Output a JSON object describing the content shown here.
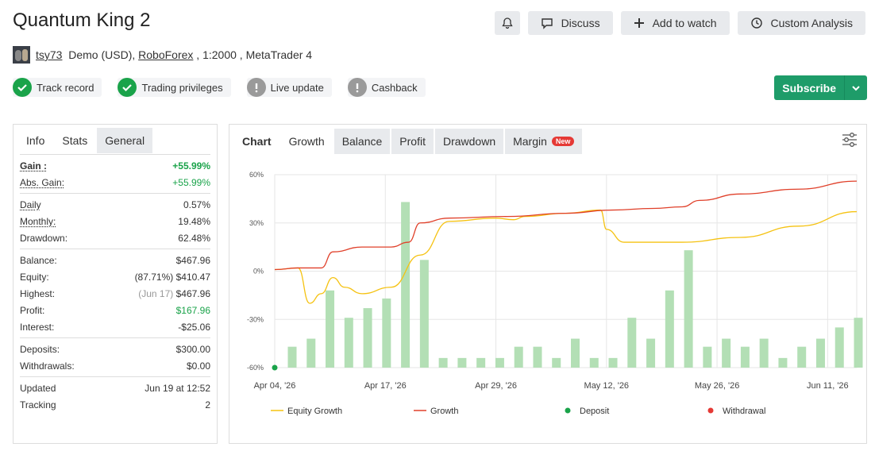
{
  "header": {
    "title": "Quantum King 2",
    "user": "tsy73",
    "account_type": "Demo (USD),",
    "broker": "RoboForex",
    "leverage_platform": " , 1:2000 , MetaTrader 4"
  },
  "actions": {
    "discuss": "Discuss",
    "add_to_watch": "Add to watch",
    "custom_analysis": "Custom Analysis",
    "subscribe": "Subscribe"
  },
  "badges": [
    {
      "label": "Track record",
      "status": "ok"
    },
    {
      "label": "Trading privileges",
      "status": "ok"
    },
    {
      "label": "Live update",
      "status": "warn"
    },
    {
      "label": "Cashback",
      "status": "warn"
    }
  ],
  "left_tabs": [
    "Info",
    "Stats",
    "General"
  ],
  "stats": {
    "gain_label": "Gain :",
    "gain": "+55.99%",
    "abs_gain_label": "Abs. Gain:",
    "abs_gain": "+55.99%",
    "daily_label": "Daily",
    "daily": "0.57%",
    "monthly_label": "Monthly:",
    "monthly": "19.48%",
    "drawdown_label": "Drawdown:",
    "drawdown": "62.48%",
    "balance_label": "Balance:",
    "balance": "$467.96",
    "equity_label": "Equity:",
    "equity_pct": "(87.71%)",
    "equity": "$410.47",
    "highest_label": "Highest:",
    "highest_date": "(Jun 17)",
    "highest": "$467.96",
    "profit_label": "Profit:",
    "profit": "$167.96",
    "interest_label": "Interest:",
    "interest": "-$25.06",
    "deposits_label": "Deposits:",
    "deposits": "$300.00",
    "withdrawals_label": "Withdrawals:",
    "withdrawals": "$0.00",
    "updated_label": "Updated",
    "updated": "Jun 19 at 12:52",
    "tracking_label": "Tracking",
    "tracking": "2"
  },
  "chart_tabs": {
    "chart": "Chart",
    "growth": "Growth",
    "balance": "Balance",
    "profit": "Profit",
    "drawdown": "Drawdown",
    "margin": "Margin",
    "new_badge": "New"
  },
  "colors": {
    "equity": "#f5c211",
    "growth": "#e0402a",
    "bars": "#b3dfb5",
    "deposit": "#1aa34a",
    "withdrawal": "#e53935"
  },
  "chart_data": {
    "type": "bar+line",
    "y_ticks": [
      "60%",
      "30%",
      "0%",
      "-30%",
      "-60%"
    ],
    "ylim": [
      -60,
      60
    ],
    "x_ticks": [
      "Apr 04, '26",
      "Apr 17, '26",
      "Apr 29, '26",
      "May 12, '26",
      "May 26, '26",
      "Jun 11, '26"
    ],
    "x_tick_pos": [
      0.0,
      0.19,
      0.38,
      0.57,
      0.76,
      0.95
    ],
    "bars": [
      -47,
      -42,
      -12,
      -29,
      -23,
      -17,
      43,
      7,
      -54,
      -54,
      -54,
      -54,
      -47,
      -47,
      -54,
      -42,
      -54,
      -54,
      -29,
      -42,
      -12,
      13,
      -47,
      -42,
      -47,
      -42,
      -54,
      -47,
      -42,
      -35,
      -29
    ],
    "growth": [
      [
        0.0,
        1
      ],
      [
        0.04,
        2
      ],
      [
        0.08,
        2
      ],
      [
        0.1,
        12
      ],
      [
        0.15,
        15
      ],
      [
        0.2,
        15
      ],
      [
        0.23,
        18
      ],
      [
        0.25,
        30
      ],
      [
        0.3,
        33
      ],
      [
        0.4,
        34
      ],
      [
        0.5,
        36
      ],
      [
        0.58,
        38
      ],
      [
        0.65,
        39
      ],
      [
        0.7,
        40
      ],
      [
        0.73,
        44
      ],
      [
        0.8,
        48
      ],
      [
        0.9,
        51
      ],
      [
        1.0,
        56
      ]
    ],
    "equity": [
      [
        0.0,
        1
      ],
      [
        0.04,
        2
      ],
      [
        0.06,
        -20
      ],
      [
        0.08,
        -14
      ],
      [
        0.1,
        -4
      ],
      [
        0.12,
        -10
      ],
      [
        0.15,
        -14
      ],
      [
        0.2,
        -10
      ],
      [
        0.25,
        10
      ],
      [
        0.3,
        31
      ],
      [
        0.38,
        33
      ],
      [
        0.41,
        32
      ],
      [
        0.43,
        34
      ],
      [
        0.5,
        36
      ],
      [
        0.56,
        38
      ],
      [
        0.57,
        26
      ],
      [
        0.6,
        18
      ],
      [
        0.7,
        18
      ],
      [
        0.8,
        21
      ],
      [
        0.9,
        28
      ],
      [
        1.0,
        37
      ]
    ],
    "deposit": [
      [
        0.0,
        -60
      ]
    ],
    "legend": [
      "Equity Growth",
      "Growth",
      "Deposit",
      "Withdrawal"
    ]
  }
}
